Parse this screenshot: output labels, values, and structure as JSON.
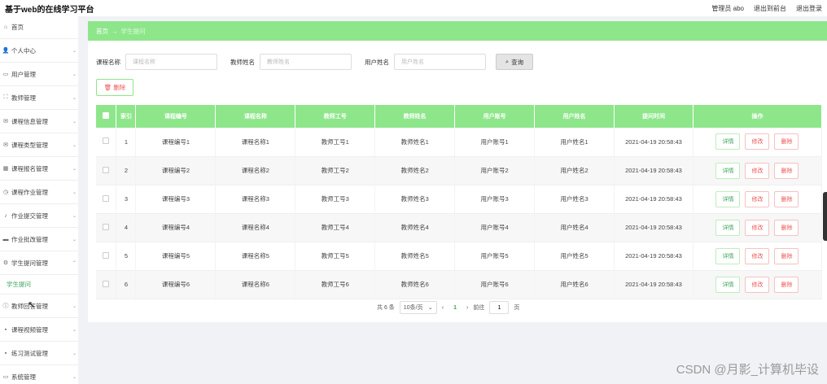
{
  "app": {
    "title": "基于web的在线学习平台",
    "user_label": "管理员 abo",
    "back_front": "退出到前台",
    "logout": "退出登录"
  },
  "sidebar": {
    "items": [
      {
        "label": "首页",
        "icon": "home-icon"
      },
      {
        "label": "个人中心",
        "icon": "user-icon"
      },
      {
        "label": "用户管理",
        "icon": "id-card-icon"
      },
      {
        "label": "教师管理",
        "icon": "expand-icon"
      },
      {
        "label": "课程信息管理",
        "icon": "mail-icon"
      },
      {
        "label": "课程类型管理",
        "icon": "mail-icon"
      },
      {
        "label": "课程报名管理",
        "icon": "bank-icon"
      },
      {
        "label": "课程作业管理",
        "icon": "clock-icon"
      },
      {
        "label": "作业提交管理",
        "icon": "mic-icon"
      },
      {
        "label": "作业批改管理",
        "icon": "chat-icon"
      },
      {
        "label": "学生提问管理",
        "icon": "gear-icon"
      },
      {
        "label": "学生提问",
        "sub": true
      },
      {
        "label": "教师回答管理",
        "icon": "info-icon"
      },
      {
        "label": "课程视频管理",
        "icon": "grid-icon"
      },
      {
        "label": "练习测试管理",
        "icon": "grid-icon"
      },
      {
        "label": "系统管理",
        "icon": "monitor-icon"
      }
    ]
  },
  "breadcrumb": {
    "home": "首页",
    "arrow": "→",
    "current": "学生提问"
  },
  "search": {
    "course_name_label": "课程名称",
    "course_name_placeholder": "课程名称",
    "teacher_name_label": "教师姓名",
    "teacher_name_placeholder": "教师姓名",
    "user_name_label": "用户姓名",
    "user_name_placeholder": "用户姓名",
    "search_button": "查询",
    "delete_button": "删除"
  },
  "table": {
    "headers": [
      "索引",
      "课程编号",
      "课程名称",
      "教师工号",
      "教师姓名",
      "用户账号",
      "用户姓名",
      "提问时间",
      "操作"
    ],
    "rows": [
      {
        "index": "1",
        "course_no": "课程编号1",
        "course_name": "课程名称1",
        "teacher_no": "教师工号1",
        "teacher_name": "教师姓名1",
        "user_account": "用户账号1",
        "user_name": "用户姓名1",
        "time": "2021-04-19 20:58:43"
      },
      {
        "index": "2",
        "course_no": "课程编号2",
        "course_name": "课程名称2",
        "teacher_no": "教师工号2",
        "teacher_name": "教师姓名2",
        "user_account": "用户账号2",
        "user_name": "用户姓名2",
        "time": "2021-04-19 20:58:43"
      },
      {
        "index": "3",
        "course_no": "课程编号3",
        "course_name": "课程名称3",
        "teacher_no": "教师工号3",
        "teacher_name": "教师姓名3",
        "user_account": "用户账号3",
        "user_name": "用户姓名3",
        "time": "2021-04-19 20:58:43"
      },
      {
        "index": "4",
        "course_no": "课程编号4",
        "course_name": "课程名称4",
        "teacher_no": "教师工号4",
        "teacher_name": "教师姓名4",
        "user_account": "用户账号4",
        "user_name": "用户姓名4",
        "time": "2021-04-19 20:58:43"
      },
      {
        "index": "5",
        "course_no": "课程编号5",
        "course_name": "课程名称5",
        "teacher_no": "教师工号5",
        "teacher_name": "教师姓名5",
        "user_account": "用户账号5",
        "user_name": "用户姓名5",
        "time": "2021-04-19 20:58:43"
      },
      {
        "index": "6",
        "course_no": "课程编号6",
        "course_name": "课程名称6",
        "teacher_no": "教师工号6",
        "teacher_name": "教师姓名6",
        "user_account": "用户账号6",
        "user_name": "用户姓名6",
        "time": "2021-04-19 20:58:43"
      }
    ],
    "op_detail": "详情",
    "op_edit": "修改",
    "op_delete": "删除"
  },
  "pagination": {
    "total": "共 6 条",
    "page_size": "10条/页",
    "current_page": "1",
    "goto_label": "前往",
    "goto_value": "1",
    "page_suffix": "页"
  },
  "watermark": "CSDN @月影_计算机毕设",
  "colors": {
    "accent": "#8ee68b",
    "danger": "#e55555",
    "link": "#3aa55a"
  }
}
